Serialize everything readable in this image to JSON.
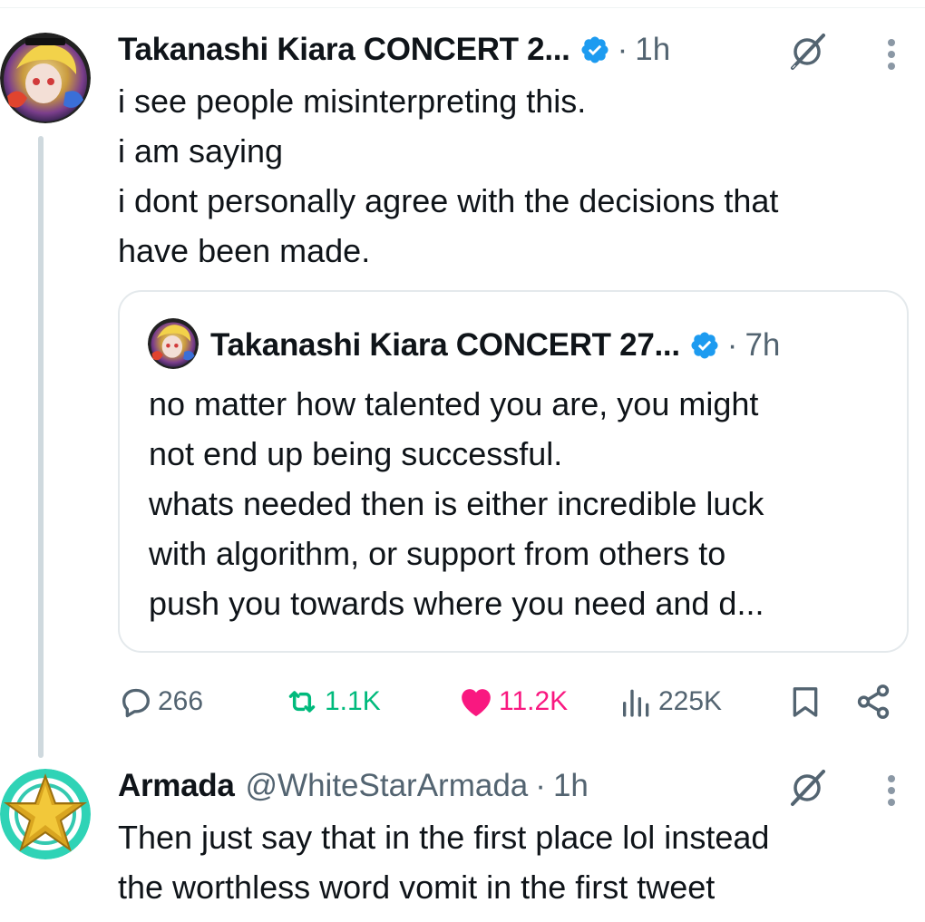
{
  "thread": {
    "tweet": {
      "display_name": "Takanashi Kiara CONCERT 2...",
      "time": "1h",
      "dot": "·",
      "text_lines": [
        "i see people misinterpreting this.",
        "i am saying",
        "i dont personally agree with the decisions that",
        "have been made."
      ],
      "quoted": {
        "display_name": "Takanashi Kiara CONCERT 27...",
        "time": "7h",
        "text_lines": [
          "no matter how talented you are, you might",
          "not end up being successful.",
          "whats needed then is either incredible luck",
          "with algorithm, or support from others to",
          "push you towards where you need and d..."
        ]
      },
      "actions": {
        "replies": "266",
        "reposts": "1.1K",
        "likes": "11.2K",
        "views": "225K"
      }
    },
    "reply": {
      "display_name": "Armada",
      "handle": "@WhiteStarArmada",
      "time": "1h",
      "text_lines": [
        "Then just say that in the first place lol instead",
        "the worthless word vomit in the first tweet"
      ]
    }
  },
  "colors": {
    "verified": "#1d9bf0",
    "repost": "#00ba7c",
    "like": "#f91880",
    "muted": "#536471",
    "thread_line": "#cfd9de"
  },
  "icons": [
    "verified-badge-icon",
    "grok-icon",
    "more-icon",
    "reply-icon",
    "repost-icon",
    "heart-icon",
    "views-icon",
    "bookmark-icon",
    "share-icon"
  ]
}
